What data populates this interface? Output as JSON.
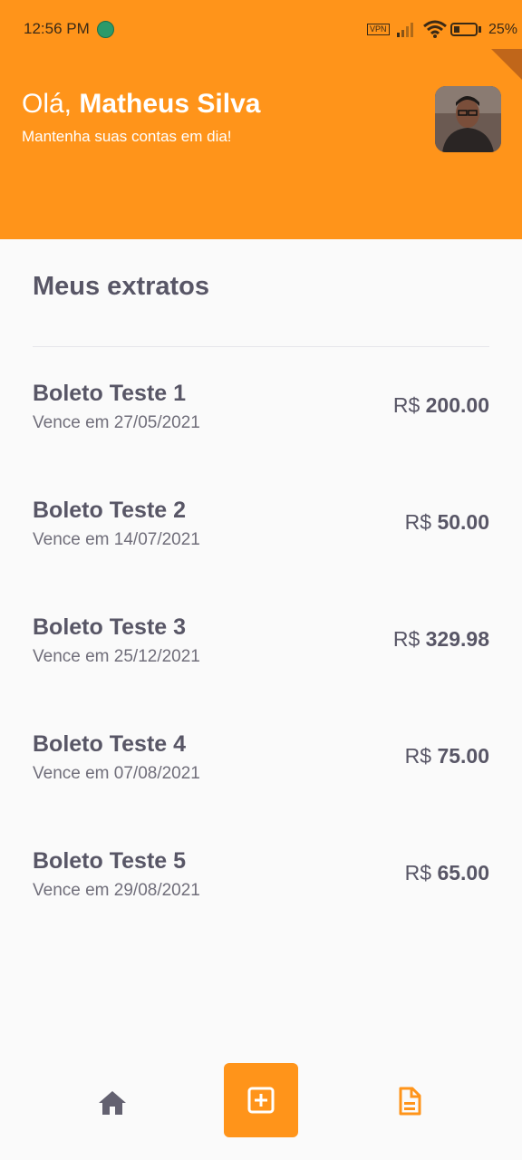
{
  "status_bar": {
    "time": "12:56 PM",
    "vpn_label": "VPN",
    "battery_percent": "25%"
  },
  "header": {
    "greeting": "Olá,",
    "user_name": "Matheus Silva",
    "subtitle": "Mantenha suas contas em dia!",
    "avatar_icon": "user-photo"
  },
  "section": {
    "title": "Meus extratos"
  },
  "bills": [
    {
      "name": "Boleto Teste 1",
      "due": "Vence em 27/05/2021",
      "currency": "R$",
      "amount": "200.00"
    },
    {
      "name": "Boleto Teste 2",
      "due": "Vence em 14/07/2021",
      "currency": "R$",
      "amount": "50.00"
    },
    {
      "name": "Boleto Teste 3",
      "due": "Vence em 25/12/2021",
      "currency": "R$",
      "amount": "329.98"
    },
    {
      "name": "Boleto Teste 4",
      "due": "Vence em 07/08/2021",
      "currency": "R$",
      "amount": "75.00"
    },
    {
      "name": "Boleto Teste 5",
      "due": "Vence em 29/08/2021",
      "currency": "R$",
      "amount": "65.00"
    }
  ],
  "bottom_nav": {
    "items": [
      {
        "icon": "home-icon"
      },
      {
        "icon": "add-box-icon"
      },
      {
        "icon": "document-icon"
      }
    ]
  },
  "colors": {
    "primary": "#FF941A",
    "heading": "#585666",
    "body": "#706E7A",
    "background": "#FAFAFA"
  }
}
